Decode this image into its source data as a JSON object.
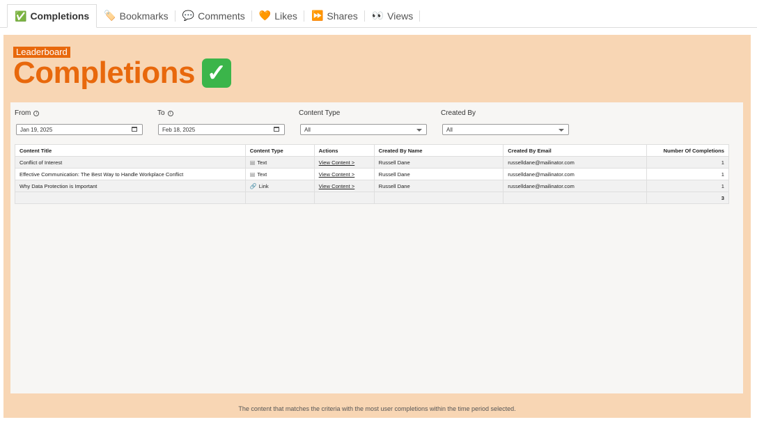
{
  "tabs": [
    {
      "label": "Completions",
      "icon": "check-icon",
      "glyph": "✅",
      "active": true
    },
    {
      "label": "Bookmarks",
      "icon": "bookmark-icon",
      "glyph": "🏷️",
      "active": false
    },
    {
      "label": "Comments",
      "icon": "speech-bubble-icon",
      "glyph": "💬",
      "active": false
    },
    {
      "label": "Likes",
      "icon": "heart-icon",
      "glyph": "🧡",
      "active": false
    },
    {
      "label": "Shares",
      "icon": "fast-forward-icon",
      "glyph": "⏩",
      "active": false
    },
    {
      "label": "Views",
      "icon": "eyes-icon",
      "glyph": "👀",
      "active": false
    }
  ],
  "header": {
    "badge": "Leaderboard",
    "title": "Completions",
    "title_icon": "✓"
  },
  "filters": {
    "from_label": "From",
    "from_value": "Jan 19, 2025",
    "to_label": "To",
    "to_value": "Feb 18, 2025",
    "content_type_label": "Content Type",
    "content_type_value": "All",
    "created_by_label": "Created By",
    "created_by_value": "All"
  },
  "table": {
    "columns": [
      "Content Title",
      "Content Type",
      "Actions",
      "Created By Name",
      "Created By Email",
      "Number Of Completions"
    ],
    "rows": [
      {
        "title": "Conflict of Interest",
        "type_icon": "document-icon",
        "type": "Text",
        "action": "View Content >",
        "name": "Russell Dane",
        "email": "russelldane@mailinator.com",
        "count": "1"
      },
      {
        "title": "Effective Communication: The Best Way to Handle Workplace Conflict",
        "type_icon": "document-icon",
        "type": "Text",
        "action": "View Content >",
        "name": "Russell Dane",
        "email": "russelldane@mailinator.com",
        "count": "1"
      },
      {
        "title": "Why Data Protection is Important",
        "type_icon": "link-icon",
        "type": "Link",
        "action": "View Content >",
        "name": "Russell Dane",
        "email": "russelldane@mailinator.com",
        "count": "1"
      }
    ],
    "total": "3"
  },
  "footer": {
    "text": "The content that matches the criteria with the most user completions within the time period selected."
  },
  "colors": {
    "accent": "#e8680c",
    "panel_bg": "#f8d6b4",
    "inner_bg": "#f7f6f4",
    "check_green": "#3bb54a"
  }
}
